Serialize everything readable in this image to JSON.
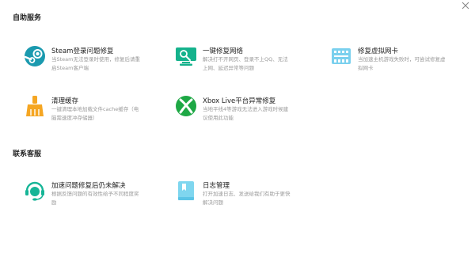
{
  "close": {
    "icon": "close-icon"
  },
  "sections": {
    "self_service": "自助服务",
    "contact": "联系客服"
  },
  "items": {
    "steam": {
      "title": "Steam登录问题修复",
      "desc1": "当Steam无法登录时使用，修复后请重",
      "desc2": "启Steam客户端",
      "icon": "steam-icon",
      "color": "#1b9aaf"
    },
    "network": {
      "title": "一键修复网络",
      "desc1": "解决打不开网页、登录不上QQ、无法",
      "desc2": "上网、延迟异常等问题",
      "icon": "network-repair-icon",
      "color": "#15b28c"
    },
    "vnic": {
      "title": "修复虚拟网卡",
      "desc1": "当加速主机游戏失败时，可尝试修复虚",
      "desc2": "拟网卡",
      "icon": "virtual-nic-icon",
      "color": "#7ad0ee"
    },
    "cache": {
      "title": "清理缓存",
      "desc1": "一键清理本地加载文件cache缓存（电",
      "desc2": "脑需速度冲存储器）",
      "icon": "broom-icon",
      "color": "#f5a623"
    },
    "xbox": {
      "title": "Xbox Live平台异常修复",
      "desc1": "当地平线4等游戏无法进入游戏时候建",
      "desc2": "议使用此功能",
      "icon": "xbox-icon",
      "color": "#1ea845"
    },
    "accel": {
      "title": "加速问题修复后仍未解决",
      "desc1": "根据反馈问题的有效性给予不同程度奖",
      "desc2": "励",
      "icon": "support-agent-icon",
      "color": "#16b597"
    },
    "log": {
      "title": "日志管理",
      "desc1": "打开加速日志、发送给我们有助于更快",
      "desc2": "解决问题",
      "icon": "log-file-icon",
      "color": "#7fd6ef"
    }
  }
}
